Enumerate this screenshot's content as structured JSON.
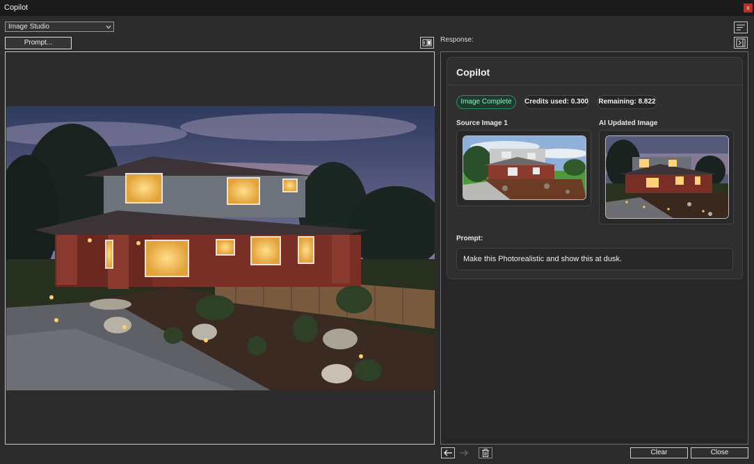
{
  "window": {
    "title": "Copilot",
    "close_glyph": "x"
  },
  "toolbar": {
    "mode_select": "Image Studio",
    "prompt_button": "Prompt..."
  },
  "response": {
    "label": "Response:",
    "card_title": "Copilot",
    "status_badge": "Image Complete",
    "credits_used": "Credits used: 0.300",
    "remaining": "Remaining: 8.822",
    "source_label": "Source Image 1",
    "updated_label": "AI Updated Image",
    "prompt_label": "Prompt:",
    "prompt_text": "Make this Photorealistic and show this at dusk."
  },
  "footer": {
    "clear_button": "Clear",
    "close_button": "Close"
  },
  "colors": {
    "status_green": "#8ff0bd",
    "close_red": "#c42b1c",
    "background": "#2b2b2b"
  },
  "icons": [
    "split-view-icon",
    "sort-lines-icon",
    "collapse-panel-icon",
    "back-arrow-icon",
    "forward-arrow-icon",
    "trash-icon"
  ]
}
